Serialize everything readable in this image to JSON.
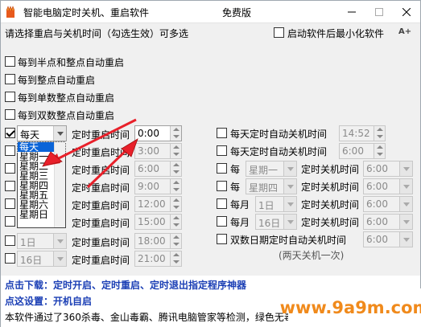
{
  "window": {
    "title": "智能电脑定时关机、重启软件",
    "badge": "免费版"
  },
  "top": {
    "instruction": "请选择重启与关机时间（勾选生效）可多选",
    "minimize_on_start": "启动软件后最小化软件",
    "font_size_label": "A+"
  },
  "restart": {
    "half_hour": "每到半点和整点自动重启",
    "full_hour": "每到整点自动重启",
    "odd_hour": "每到单数整点自动重启",
    "even_hour": "每到双数整点自动重启",
    "row_label": "定时重启时间",
    "rows": [
      {
        "select": "每天",
        "time": "0:00"
      },
      {
        "select": "",
        "time": "3:00"
      },
      {
        "select": "",
        "time": "6:00"
      },
      {
        "select": "",
        "time": "9:00"
      },
      {
        "select": "",
        "time": "12:00"
      },
      {
        "select": "",
        "time": "15:00"
      },
      {
        "select": "1日",
        "time": "18:00"
      },
      {
        "select": "16日",
        "time": "21:00"
      }
    ],
    "dropdown_options": [
      "每天",
      "星期一",
      "星期二",
      "星期三",
      "星期四",
      "星期五",
      "星期六",
      "星期日"
    ]
  },
  "shutdown": {
    "daily1": "每天定时自动关机时间",
    "daily1_time": "14:52",
    "daily2": "每天定时自动关机时间",
    "daily2_time": "6:00",
    "weekly_prefix": "每",
    "weekly1_day": "星期一",
    "weekly2_day": "星期四",
    "label": "定时关机时间",
    "weekly1_time": "6:00",
    "weekly2_time": "6:00",
    "monthly_prefix": "每月",
    "monthly1_day": "1日",
    "monthly2_day": "16日",
    "monthly1_time": "6:00",
    "monthly2_time": "6:00",
    "even_date": "双数日期定时自动关机时间",
    "even_date_time": "6:00",
    "note": "(两天关机一次)"
  },
  "footer": {
    "download": "点击下载：定时开启、定时重启、定时退出指定程序神器",
    "settings": "点这设置：开机自启",
    "virus": "本软件通过了360杀毒、金山毒霸、腾讯电脑管家等检测，绿色无毒"
  },
  "watermark": "www.9a9m.com",
  "colors": {
    "accent": "#0a64d8",
    "link": "#1b3fb5",
    "arrow": "#e8202a",
    "watermark": "#f08a1c"
  }
}
